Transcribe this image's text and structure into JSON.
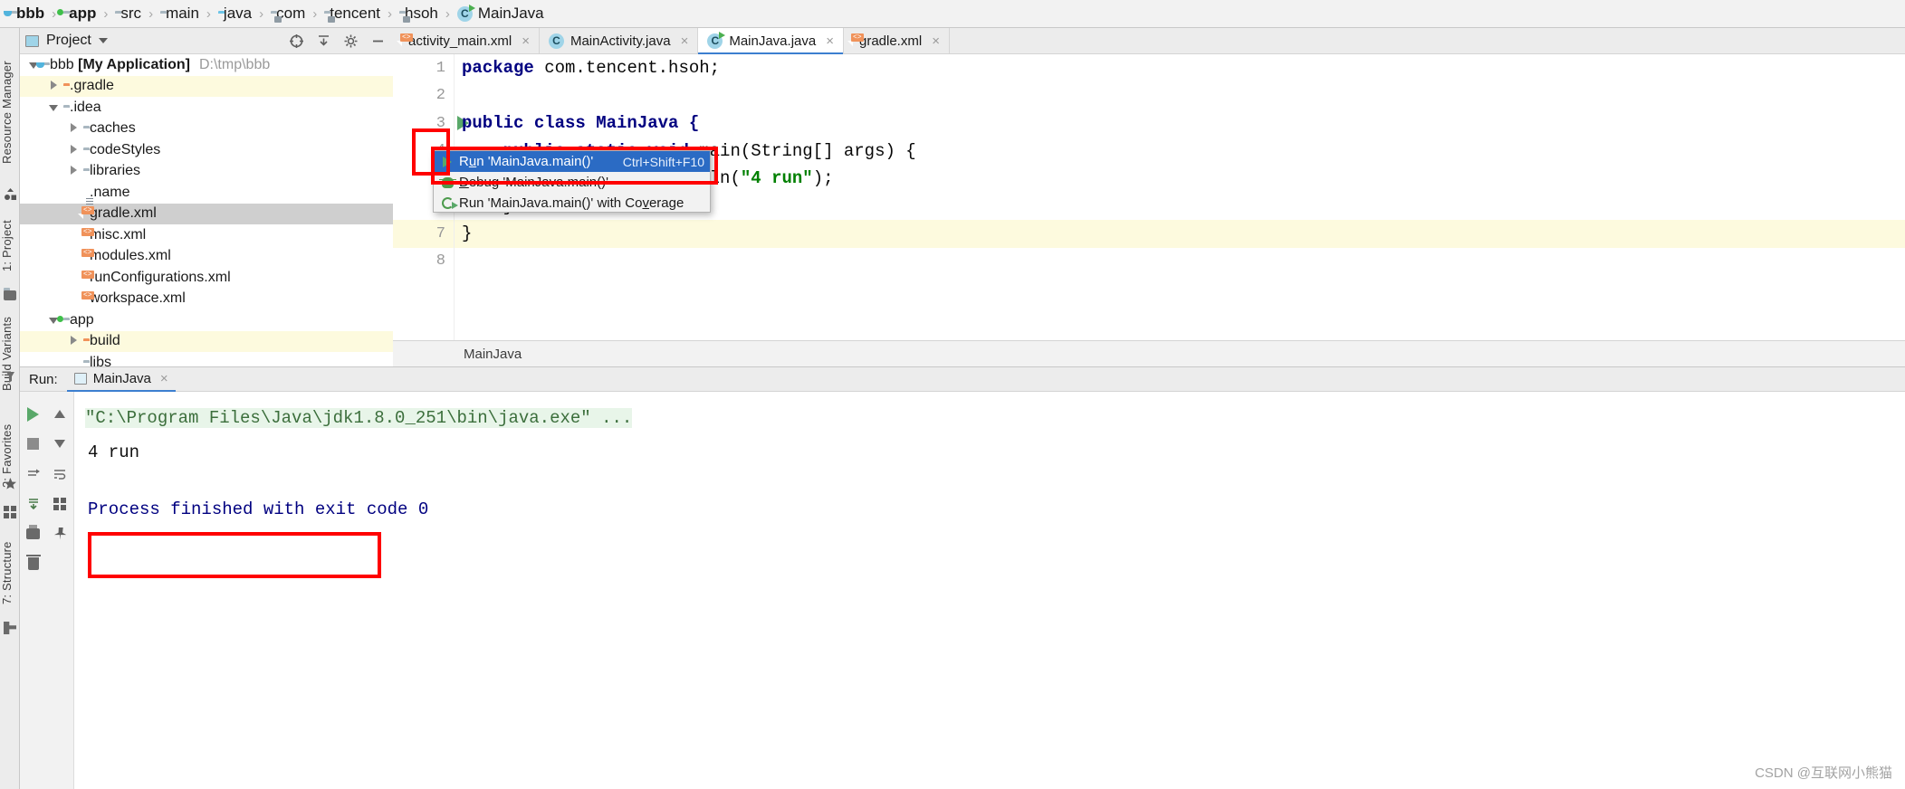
{
  "navbar": {
    "crumbs": [
      {
        "label": "bbb",
        "icon": "module-folder-icon",
        "bold": true
      },
      {
        "label": "app",
        "icon": "module-folder-icon",
        "bold": true
      },
      {
        "label": "src",
        "icon": "folder-icon",
        "bold": false
      },
      {
        "label": "main",
        "icon": "folder-icon",
        "bold": false
      },
      {
        "label": "java",
        "icon": "source-folder-icon",
        "bold": false
      },
      {
        "label": "com",
        "icon": "package-folder-icon",
        "bold": false
      },
      {
        "label": "tencent",
        "icon": "package-folder-icon",
        "bold": false
      },
      {
        "label": "hsoh",
        "icon": "package-folder-icon",
        "bold": false
      },
      {
        "label": "MainJava",
        "icon": "java-class-runnable-icon",
        "bold": false
      }
    ],
    "separator": "›"
  },
  "left_strip": {
    "items": [
      {
        "label": "Resource Manager",
        "icon": "resource-manager-icon"
      },
      {
        "label": "1: Project",
        "icon": "project-icon"
      },
      {
        "label": "Build Variants",
        "icon": "build-variants-icon"
      },
      {
        "label": "2: Favorites",
        "icon": "favorites-star-icon"
      },
      {
        "label": "7: Structure",
        "icon": "structure-icon"
      }
    ]
  },
  "project_panel": {
    "title": "Project",
    "title_icon": "project-view-icon",
    "toolbar": [
      {
        "name": "locate-icon",
        "glyph": "⊕"
      },
      {
        "name": "collapse-all-icon",
        "glyph": "⤓"
      },
      {
        "name": "settings-gear-icon",
        "glyph": "⚙"
      },
      {
        "name": "hide-icon",
        "glyph": "−"
      }
    ],
    "tree": [
      {
        "label": "bbb",
        "bold_label": "[My Application]",
        "path": "D:\\tmp\\bbb",
        "indent": 0,
        "twisty": "down",
        "icon": "module-folder-icon",
        "state": "none"
      },
      {
        "label": ".gradle",
        "indent": 1,
        "twisty": "right",
        "icon": "orange-folder-icon",
        "state": "highlight"
      },
      {
        "label": ".idea",
        "indent": 1,
        "twisty": "down",
        "icon": "folder-icon",
        "state": "none"
      },
      {
        "label": "caches",
        "indent": 2,
        "twisty": "right",
        "icon": "folder-icon",
        "state": "none"
      },
      {
        "label": "codeStyles",
        "indent": 2,
        "twisty": "right",
        "icon": "folder-icon",
        "state": "none"
      },
      {
        "label": "libraries",
        "indent": 2,
        "twisty": "right",
        "icon": "folder-icon",
        "state": "none"
      },
      {
        "label": ".name",
        "indent": 2,
        "twisty": "none",
        "icon": "text-file-icon",
        "state": "none"
      },
      {
        "label": "gradle.xml",
        "indent": 2,
        "twisty": "none",
        "icon": "xml-file-icon",
        "state": "selected"
      },
      {
        "label": "misc.xml",
        "indent": 2,
        "twisty": "none",
        "icon": "xml-file-icon",
        "state": "none"
      },
      {
        "label": "modules.xml",
        "indent": 2,
        "twisty": "none",
        "icon": "xml-file-icon",
        "state": "none"
      },
      {
        "label": "runConfigurations.xml",
        "indent": 2,
        "twisty": "none",
        "icon": "xml-file-icon",
        "state": "none"
      },
      {
        "label": "workspace.xml",
        "indent": 2,
        "twisty": "none",
        "icon": "xml-file-icon",
        "state": "none"
      },
      {
        "label": "app",
        "indent": 1,
        "twisty": "down",
        "icon": "module-folder-icon",
        "state": "none"
      },
      {
        "label": "build",
        "indent": 2,
        "twisty": "right",
        "icon": "orange-folder-icon",
        "state": "highlight"
      },
      {
        "label": "libs",
        "indent": 2,
        "twisty": "none",
        "icon": "folder-icon",
        "state": "none"
      }
    ]
  },
  "editor": {
    "tabs": [
      {
        "label": "activity_main.xml",
        "icon": "xml-file-icon",
        "active": false,
        "close": "×"
      },
      {
        "label": "MainActivity.java",
        "icon": "java-class-icon",
        "active": false,
        "close": "×"
      },
      {
        "label": "MainJava.java",
        "icon": "java-class-runnable-icon",
        "active": true,
        "close": "×"
      },
      {
        "label": "gradle.xml",
        "icon": "xml-file-icon",
        "active": false,
        "close": "×"
      }
    ],
    "line_numbers": [
      "1",
      "2",
      "3",
      "4",
      "5",
      "6",
      "7",
      "8"
    ],
    "code_lines": [
      {
        "n": 1,
        "segments": [
          {
            "t": "package",
            "c": "kw"
          },
          {
            "t": " com.tencent.hsoh;",
            "c": "plain"
          }
        ],
        "highlight": false
      },
      {
        "n": 2,
        "segments": [],
        "highlight": false
      },
      {
        "n": 3,
        "segments": [
          {
            "t": "public class MainJava {",
            "c": "kw"
          }
        ],
        "highlight": false,
        "run_marker": true
      },
      {
        "n": 4,
        "segments": [
          {
            "t": "    public static void",
            "c": "kw"
          },
          {
            "t": " main(String[] args) {",
            "c": "plain"
          }
        ],
        "highlight": false
      },
      {
        "n": 5,
        "segments": [
          {
            "t": "        System.out.println(",
            "c": "plain"
          },
          {
            "t": "\"4 run\"",
            "c": "str"
          },
          {
            "t": ");",
            "c": "plain"
          }
        ],
        "highlight": false
      },
      {
        "n": 6,
        "segments": [
          {
            "t": "    }",
            "c": "plain"
          }
        ],
        "highlight": false
      },
      {
        "n": 7,
        "segments": [
          {
            "t": "}",
            "c": "plain"
          }
        ],
        "highlight": true
      },
      {
        "n": 8,
        "segments": [],
        "highlight": false
      }
    ],
    "breadcrumb_status": "MainJava"
  },
  "context_menu": {
    "items": [
      {
        "label": "Run 'MainJava.main()'",
        "mnemonic": "u",
        "shortcut": "Ctrl+Shift+F10",
        "icon": "run-green-arrow-icon",
        "selected": true
      },
      {
        "label": "Debug 'MainJava.main()'",
        "mnemonic": "D",
        "shortcut": "",
        "icon": "debug-bug-icon",
        "selected": false
      },
      {
        "label": "Run 'MainJava.main()' with Coverage",
        "mnemonic": "v",
        "shortcut": "",
        "icon": "run-coverage-icon",
        "selected": false
      }
    ]
  },
  "run_window": {
    "label": "Run:",
    "tab": {
      "label": "MainJava",
      "icon": "run-config-icon",
      "close": "×"
    },
    "toolbar_left": [
      {
        "name": "rerun-button",
        "icon": "green-play-icon"
      },
      {
        "name": "stop-button",
        "icon": "stop-square-icon"
      },
      {
        "name": "rerun-failed-button",
        "icon": "rerun-icon"
      },
      {
        "name": "print-button",
        "icon": "printer-icon"
      },
      {
        "name": "clear-all-button",
        "icon": "trash-icon"
      }
    ],
    "toolbar_right": [
      {
        "name": "up-stack-button",
        "icon": "arrow-up-icon"
      },
      {
        "name": "down-stack-button",
        "icon": "arrow-down-icon"
      },
      {
        "name": "soft-wrap-button",
        "icon": "wrap-lines-icon"
      },
      {
        "name": "scroll-to-end-button",
        "icon": "scroll-end-icon"
      },
      {
        "name": "grid-button",
        "icon": "grid-icon"
      },
      {
        "name": "pin-button",
        "icon": "pin-icon"
      }
    ],
    "console_lines": [
      {
        "text": "\"C:\\Program Files\\Java\\jdk1.8.0_251\\bin\\java.exe\" ...",
        "style": "command"
      },
      {
        "text": "4 run",
        "style": "plain"
      },
      {
        "text": "",
        "style": "plain"
      },
      {
        "text": "Process finished with exit code 0",
        "style": "info"
      }
    ]
  },
  "watermark": "CSDN @互联网小熊猫",
  "colors": {
    "accent_blue": "#2b6bc4",
    "annotation_red": "#ff0000",
    "selection_gray": "#cfcfcf",
    "highlight_yellow": "#fdfade",
    "keyword_navy": "#000080",
    "string_green": "#008000",
    "run_green": "#59a869"
  }
}
